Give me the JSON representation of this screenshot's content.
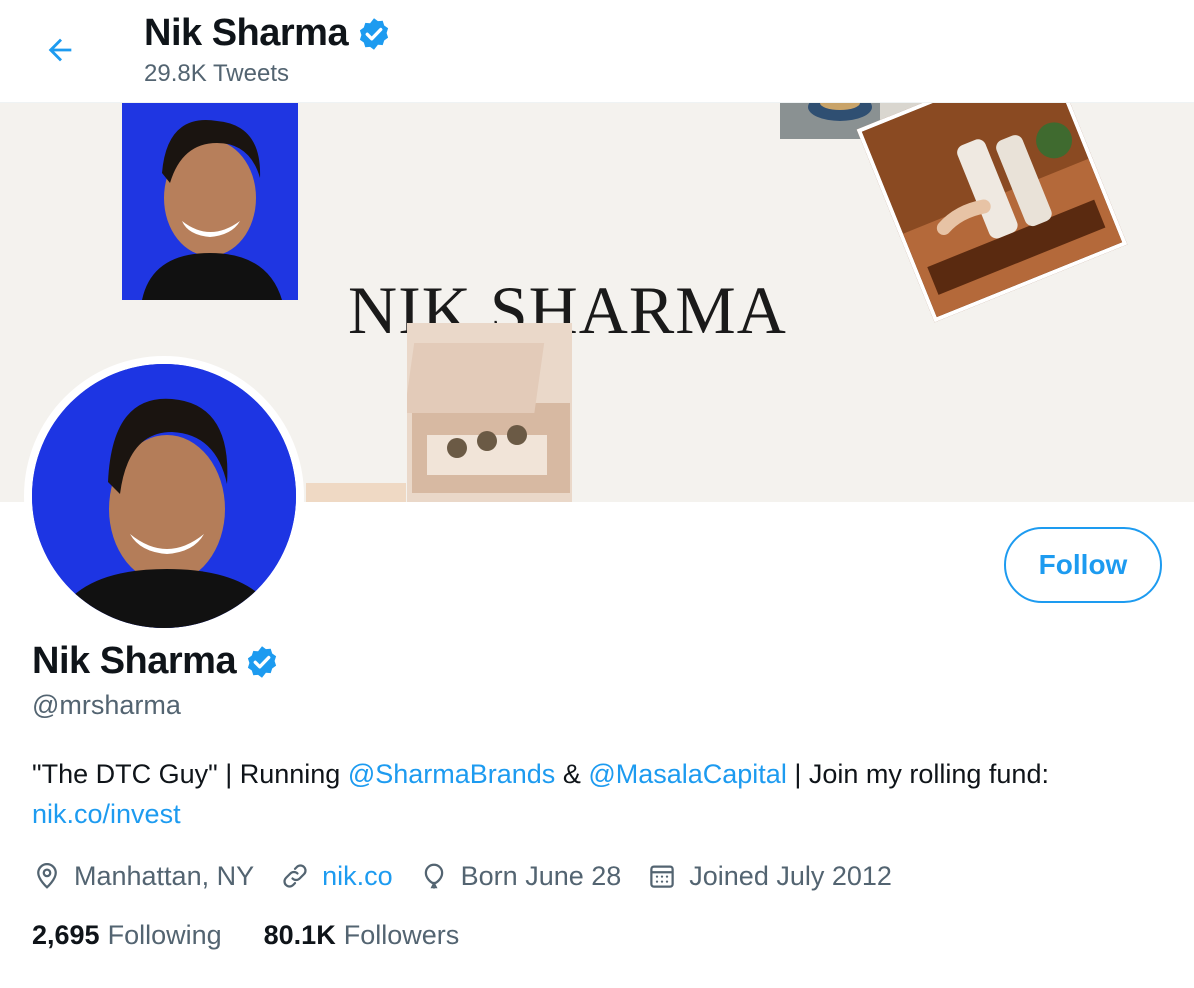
{
  "header": {
    "name": "Nik Sharma",
    "tweet_count": "29.8K Tweets"
  },
  "banner": {
    "title": "NIK SHARMA"
  },
  "profile": {
    "name": "Nik Sharma",
    "handle": "@mrsharma",
    "follow_label": "Follow",
    "bio": {
      "part1": "\"The DTC Guy\" | Running ",
      "mention1": "@SharmaBrands",
      "part2": " & ",
      "mention2": "@MasalaCapital",
      "part3": " | Join my rolling fund: ",
      "link": "nik.co/invest"
    },
    "meta": {
      "location": "Manhattan, NY",
      "website": "nik.co",
      "birthday": "Born June 28",
      "joined": "Joined July 2012"
    },
    "stats": {
      "following_count": "2,695",
      "following_label": "Following",
      "followers_count": "80.1K",
      "followers_label": "Followers"
    }
  },
  "colors": {
    "accent": "#1d9bf0",
    "text_primary": "#0f1419",
    "text_secondary": "#536471",
    "avatar_background": "#1d35e3"
  },
  "icons": [
    "back-arrow-icon",
    "verified-badge-icon",
    "location-icon",
    "link-icon",
    "balloon-icon",
    "calendar-icon"
  ]
}
